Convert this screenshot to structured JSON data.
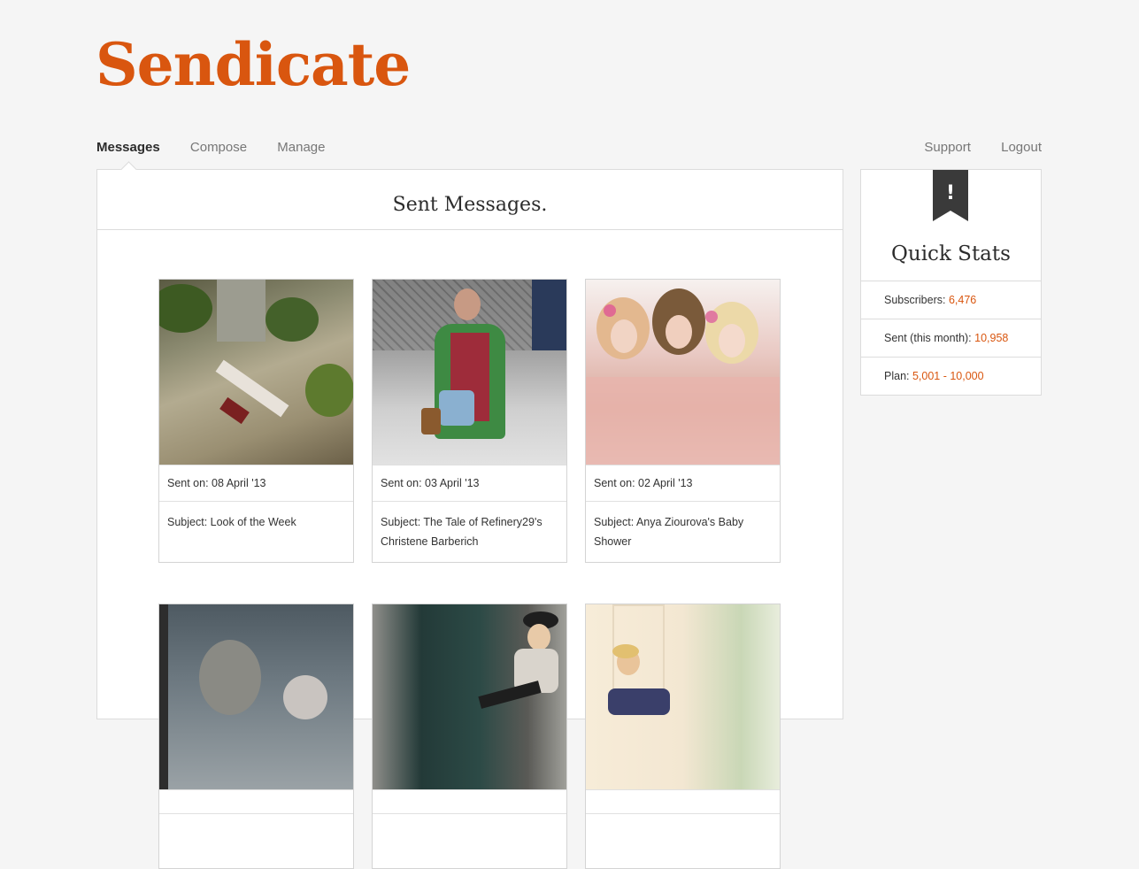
{
  "brand": {
    "name": "Sendicate",
    "accent": "#d9560f"
  },
  "nav": {
    "left": [
      {
        "label": "Messages",
        "active": true
      },
      {
        "label": "Compose",
        "active": false
      },
      {
        "label": "Manage",
        "active": false
      }
    ],
    "right": [
      {
        "label": "Support"
      },
      {
        "label": "Logout"
      }
    ]
  },
  "main": {
    "title": "Sent Messages.",
    "messages": [
      {
        "sent": "Sent on: 08 April '13",
        "subject": "Subject: Look of the Week",
        "thumb_icon": "photo-rooftop"
      },
      {
        "sent": "Sent on: 03 April '13",
        "subject": "Subject: The Tale of Refinery29's Christene Barberich",
        "thumb_icon": "photo-street-style"
      },
      {
        "sent": "Sent on: 02 April '13",
        "subject": "Subject: Anya Ziourova's Baby Shower",
        "thumb_icon": "photo-three-women"
      },
      {
        "sent": "",
        "subject": "",
        "thumb_icon": "photo-window-portrait"
      },
      {
        "sent": "",
        "subject": "",
        "thumb_icon": "photo-sitting-woman"
      },
      {
        "sent": "",
        "subject": "",
        "thumb_icon": "photo-doorway"
      }
    ]
  },
  "sidebar": {
    "ribbon_icon": "exclamation-ribbon-icon",
    "ribbon_text": "!",
    "title": "Quick Stats",
    "stats": [
      {
        "label": "Subscribers: ",
        "value": "6,476"
      },
      {
        "label": "Sent (this month): ",
        "value": "10,958"
      },
      {
        "label": "Plan: ",
        "value": "5,001 - 10,000"
      }
    ]
  }
}
